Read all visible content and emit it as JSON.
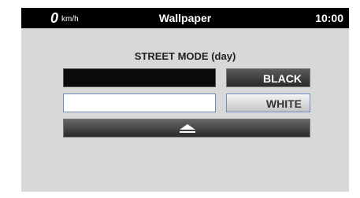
{
  "status_bar": {
    "speed": "0",
    "speed_unit": "km/h",
    "title": "Wallpaper",
    "time": "10:00"
  },
  "content": {
    "mode_label": "STREET MODE (day)",
    "options": [
      {
        "label": "BLACK",
        "swatch_color": "#000000"
      },
      {
        "label": "WHITE",
        "swatch_color": "#ffffff"
      }
    ],
    "up_button_icon": "eject-up-arrow-icon"
  }
}
